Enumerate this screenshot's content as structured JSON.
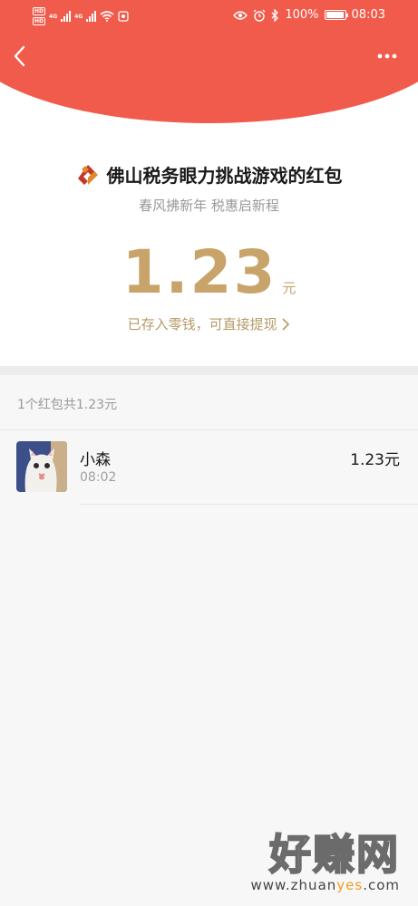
{
  "status_bar": {
    "hd1": "HD",
    "hd2": "HD",
    "net1": "4G",
    "net2": "4G",
    "battery": "100%",
    "time": "08:03"
  },
  "header": {
    "back_icon": "chevron-left-icon",
    "more_icon": "more-dots-icon",
    "color": "#f05b4b"
  },
  "packet": {
    "title": "佛山税务眼力挑战游戏的红包",
    "subtitle": "春风拂新年 税惠启新程",
    "amount": "1.23",
    "unit": "元",
    "withdraw_label": "已存入零钱，可直接提现",
    "withdraw_icon": "chevron-right-icon",
    "amount_color": "#c9a46a"
  },
  "list": {
    "summary": "1个红包共1.23元",
    "items": [
      {
        "name": "小森",
        "time": "08:02",
        "amount": "1.23元",
        "avatar_icon": "cat-avatar"
      }
    ]
  },
  "watermark": {
    "main": "好赚网",
    "domain_pre": "www.zhuan",
    "domain_hl": "yes",
    "domain_post": ".com"
  }
}
